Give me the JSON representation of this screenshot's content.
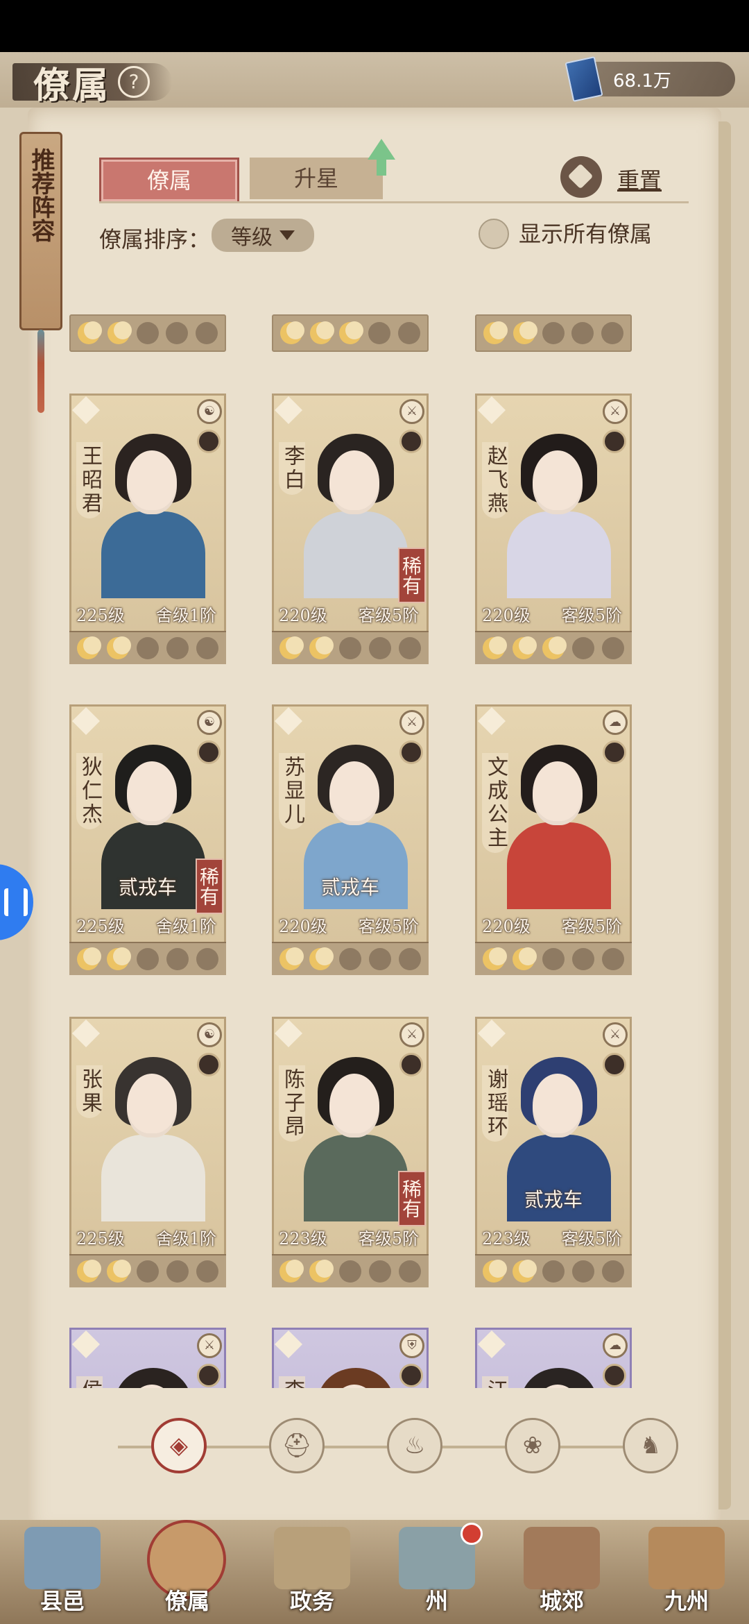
{
  "header": {
    "title": "僚属",
    "help_icon": "?",
    "currency_icon": "book-icon",
    "currency_value": "68.1万"
  },
  "recommend": {
    "label": "推荐阵容"
  },
  "tabs": [
    {
      "label": "僚属",
      "active": true
    },
    {
      "label": "升星",
      "active": false
    }
  ],
  "reset": {
    "label": "重置"
  },
  "sort": {
    "label": "僚属排序：",
    "value": "等级"
  },
  "show_all": {
    "label": "显示所有僚属",
    "checked": false
  },
  "partial_row": [
    {
      "moons": [
        true,
        true,
        false,
        false,
        false
      ]
    },
    {
      "moons": [
        true,
        true,
        true,
        false,
        false
      ]
    },
    {
      "moons": [
        true,
        true,
        false,
        false,
        false
      ]
    }
  ],
  "cards": [
    {
      "name": "王昭君",
      "level": "225级",
      "grade": "舍级1阶",
      "rare": "",
      "skill": "",
      "moons": [
        true,
        true,
        false,
        false,
        false
      ],
      "body_color": "#3c6b97",
      "hair_color": "#2b2320",
      "faction": "yinyang"
    },
    {
      "name": "李白",
      "level": "220级",
      "grade": "客级5阶",
      "rare": "稀有",
      "skill": "",
      "moons": [
        true,
        true,
        false,
        false,
        false
      ],
      "body_color": "#cfd2d8",
      "hair_color": "#2a2421",
      "faction": "sword"
    },
    {
      "name": "赵飞燕",
      "level": "220级",
      "grade": "客级5阶",
      "rare": "",
      "skill": "",
      "moons": [
        true,
        true,
        true,
        false,
        false
      ],
      "body_color": "#d8d6e6",
      "hair_color": "#221c1a",
      "faction": "sword"
    },
    {
      "name": "狄仁杰",
      "level": "225级",
      "grade": "舍级1阶",
      "rare": "稀有",
      "skill": "贰戎车",
      "moons": [
        true,
        true,
        false,
        false,
        false
      ],
      "body_color": "#2f3330",
      "hair_color": "#1f1e1c",
      "faction": "yinyang"
    },
    {
      "name": "苏显儿",
      "level": "220级",
      "grade": "客级5阶",
      "rare": "",
      "skill": "贰戎车",
      "moons": [
        true,
        true,
        false,
        false,
        false
      ],
      "body_color": "#7ea6cc",
      "hair_color": "#2c2623",
      "faction": "sword"
    },
    {
      "name": "文成公主",
      "level": "220级",
      "grade": "客级5阶",
      "rare": "",
      "skill": "",
      "moons": [
        true,
        true,
        false,
        false,
        false
      ],
      "body_color": "#c8453a",
      "hair_color": "#231d1b",
      "faction": "cloud"
    },
    {
      "name": "张果",
      "level": "225级",
      "grade": "舍级1阶",
      "rare": "",
      "skill": "",
      "moons": [
        true,
        true,
        false,
        false,
        false
      ],
      "body_color": "#e9e4da",
      "hair_color": "#383330",
      "faction": "yinyang"
    },
    {
      "name": "陈子昂",
      "level": "223级",
      "grade": "客级5阶",
      "rare": "稀有",
      "skill": "",
      "moons": [
        true,
        true,
        false,
        false,
        false
      ],
      "body_color": "#5a6a5c",
      "hair_color": "#241f1c",
      "faction": "sword"
    },
    {
      "name": "谢瑶环",
      "level": "223级",
      "grade": "客级5阶",
      "rare": "",
      "skill": "贰戎车",
      "moons": [
        true,
        true,
        false,
        false,
        false
      ],
      "body_color": "#2f4a7e",
      "hair_color": "#2e3f72",
      "faction": "sword"
    },
    {
      "name": "侯君集",
      "level": "",
      "grade": "",
      "rare": "",
      "skill": "",
      "moons": [],
      "body_color": "#6b5e7c",
      "hair_color": "#2a2320",
      "faction": "sword",
      "purple": true
    },
    {
      "name": "李元霸",
      "level": "",
      "grade": "",
      "rare": "",
      "skill": "",
      "moons": [],
      "body_color": "#7a4a2c",
      "hair_color": "#6b3b22",
      "faction": "shield",
      "purple": true
    },
    {
      "name": "江采萍",
      "level": "",
      "grade": "",
      "rare": "",
      "skill": "",
      "moons": [],
      "body_color": "#8d7fa8",
      "hair_color": "#2a2422",
      "faction": "cloud",
      "purple": true
    }
  ],
  "filters": [
    {
      "icon": "all-diamond-icon",
      "glyph": "◈",
      "active": true
    },
    {
      "icon": "helmet-icon",
      "glyph": "⛑",
      "active": false
    },
    {
      "icon": "gourd-icon",
      "glyph": "♨",
      "active": false
    },
    {
      "icon": "fan-icon",
      "glyph": "❀",
      "active": false
    },
    {
      "icon": "lion-icon",
      "glyph": "♞",
      "active": false
    }
  ],
  "bottom_nav": [
    {
      "label": "县邑",
      "icon": "county-icon",
      "color": "#7e9bb3"
    },
    {
      "label": "僚属",
      "icon": "subordinates-icon",
      "color": "#c79a6a",
      "active": true
    },
    {
      "label": "政务",
      "icon": "affairs-icon",
      "color": "#b8a07a"
    },
    {
      "label": "州",
      "icon": "state-icon",
      "color": "#8aa0a6",
      "badge": true
    },
    {
      "label": "城郊",
      "icon": "suburb-icon",
      "color": "#a27a5a"
    },
    {
      "label": "九州",
      "icon": "nine-states-icon",
      "color": "#b58a5c"
    }
  ],
  "colors": {
    "accent": "#a13c34",
    "paper": "#eae0cd",
    "tab_active": "#c9776f"
  }
}
